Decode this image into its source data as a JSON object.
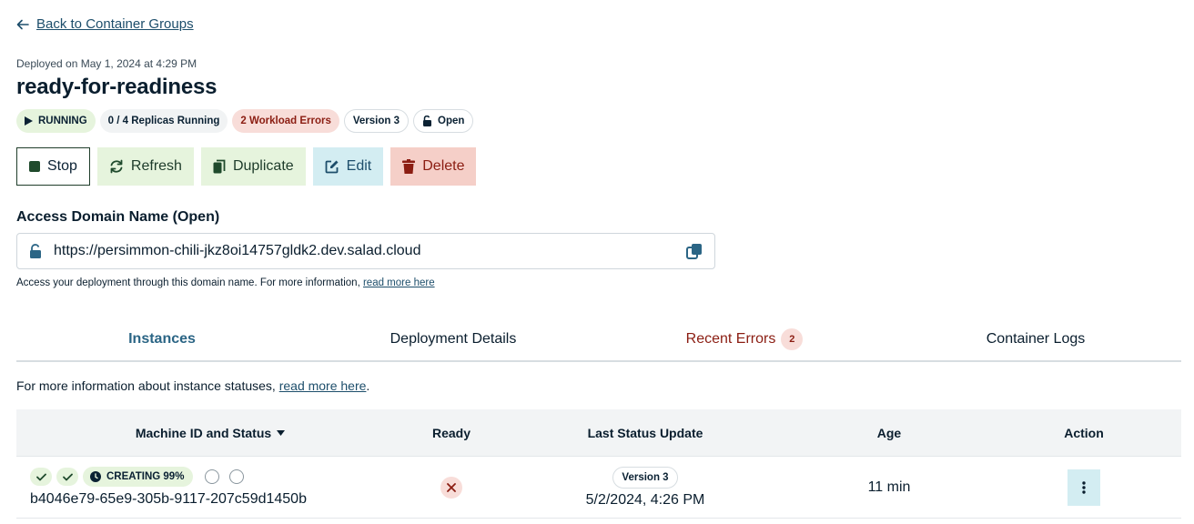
{
  "nav": {
    "back_label": "Back to Container Groups"
  },
  "header": {
    "deployed": "Deployed on May 1, 2024 at 4:29 PM",
    "title": "ready-for-readiness",
    "badges": {
      "running": "RUNNING",
      "replicas": "0 / 4 Replicas Running",
      "errors": "2 Workload Errors",
      "version": "Version 3",
      "open": "Open"
    }
  },
  "actions": {
    "stop": "Stop",
    "refresh": "Refresh",
    "duplicate": "Duplicate",
    "edit": "Edit",
    "delete": "Delete"
  },
  "domain": {
    "label": "Access Domain Name (Open)",
    "url": "https://persimmon-chili-jkz8oi14757gldk2.dev.salad.cloud",
    "help_text": "Access your deployment through this domain name. For more information, ",
    "help_link": "read more here"
  },
  "tabs": {
    "instances": "Instances",
    "deployment_details": "Deployment Details",
    "recent_errors": "Recent Errors",
    "recent_errors_count": "2",
    "container_logs": "Container Logs"
  },
  "info": {
    "text": "For more information about instance statuses, ",
    "link": "read more here",
    "suffix": "."
  },
  "table": {
    "headers": {
      "machine": "Machine ID and Status",
      "ready": "Ready",
      "last_update": "Last Status Update",
      "age": "Age",
      "action": "Action"
    },
    "rows": [
      {
        "status": "CREATING 99%",
        "machine_id": "b4046e79-65e9-305b-9117-207c59d1450b",
        "version": "Version 3",
        "date": "5/2/2024, 4:26 PM",
        "age": "11 min"
      }
    ]
  },
  "colors": {
    "green_bg": "#e6f4dd",
    "red_bg": "#f8ddd9",
    "red_text": "#8b1d12",
    "blue_bg": "#d3edf2",
    "link": "#1d4e6b"
  }
}
